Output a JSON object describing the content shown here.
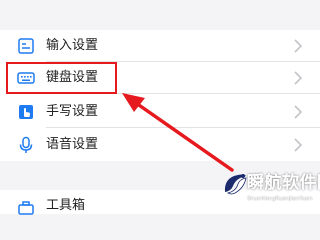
{
  "settings": {
    "items": [
      {
        "label": "输入设置",
        "icon": "input-settings-icon"
      },
      {
        "label": "键盘设置",
        "icon": "keyboard-icon"
      },
      {
        "label": "手写设置",
        "icon": "handwriting-icon"
      },
      {
        "label": "语音设置",
        "icon": "microphone-icon"
      }
    ],
    "toolbox": {
      "label": "工具箱",
      "icon": "toolbox-icon"
    }
  },
  "watermark": {
    "title": "瞬航软件园",
    "subtitle": "ShunHangRuanJianYuan"
  },
  "colors": {
    "accent_blue": "#1e7bf2",
    "highlight_red": "#e5191e",
    "background": "#f4f4f6"
  }
}
